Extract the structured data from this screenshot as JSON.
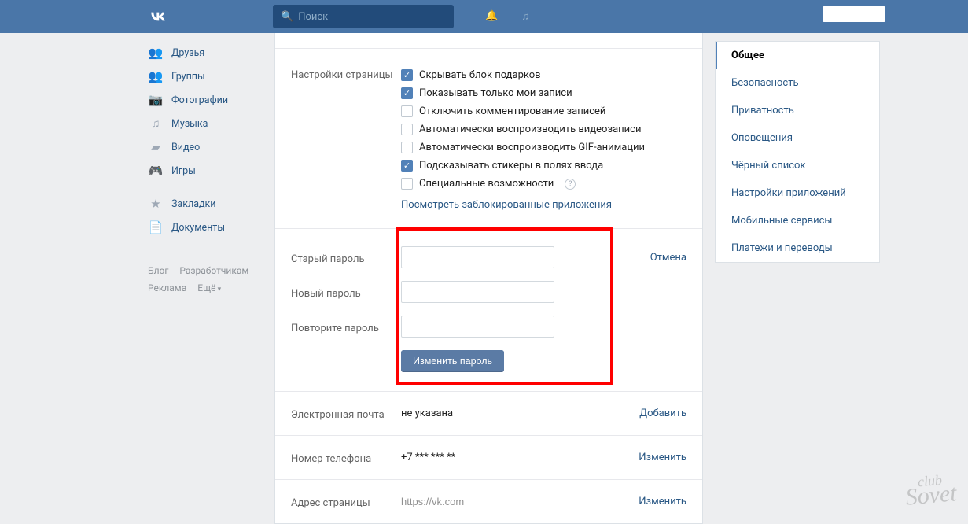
{
  "header": {
    "search_placeholder": "Поиск"
  },
  "leftnav": {
    "items": [
      {
        "icon": "👥",
        "label": "Друзья"
      },
      {
        "icon": "👥",
        "label": "Группы"
      },
      {
        "icon": "📷",
        "label": "Фотографии"
      },
      {
        "icon": "♫",
        "label": "Музыка"
      },
      {
        "icon": "▰",
        "label": "Видео"
      },
      {
        "icon": "🎮",
        "label": "Игры"
      },
      {
        "icon": "★",
        "label": "Закладки"
      },
      {
        "icon": "📄",
        "label": "Документы"
      }
    ],
    "footer": {
      "blog": "Блог",
      "devs": "Разработчикам",
      "ads": "Реклама",
      "more": "Ещё"
    }
  },
  "settings": {
    "section_label": "Настройки страницы",
    "checks": [
      {
        "checked": true,
        "label": "Скрывать блок подарков"
      },
      {
        "checked": true,
        "label": "Показывать только мои записи"
      },
      {
        "checked": false,
        "label": "Отключить комментирование записей"
      },
      {
        "checked": false,
        "label": "Автоматически воспроизводить видеозаписи"
      },
      {
        "checked": false,
        "label": "Автоматически воспроизводить GIF-анимации"
      },
      {
        "checked": true,
        "label": "Подсказывать стикеры в полях ввода"
      },
      {
        "checked": false,
        "label": "Специальные возможности",
        "help": true
      }
    ],
    "blocked_apps_link": "Посмотреть заблокированные приложения"
  },
  "password": {
    "old_label": "Старый пароль",
    "new_label": "Новый пароль",
    "repeat_label": "Повторите пароль",
    "button": "Изменить пароль",
    "cancel": "Отмена"
  },
  "email": {
    "label": "Электронная почта",
    "value": "не указана",
    "action": "Добавить"
  },
  "phone": {
    "label": "Номер телефона",
    "value": "+7 *** *** **",
    "action": "Изменить"
  },
  "address": {
    "label": "Адрес страницы",
    "value": "https://vk.com",
    "action": "Изменить"
  },
  "rightmenu": {
    "items": [
      "Общее",
      "Безопасность",
      "Приватность",
      "Оповещения",
      "Чёрный список",
      "Настройки приложений",
      "Мобильные сервисы",
      "Платежи и переводы"
    ]
  },
  "watermark": {
    "l1": "club",
    "l2": "Sovet"
  }
}
